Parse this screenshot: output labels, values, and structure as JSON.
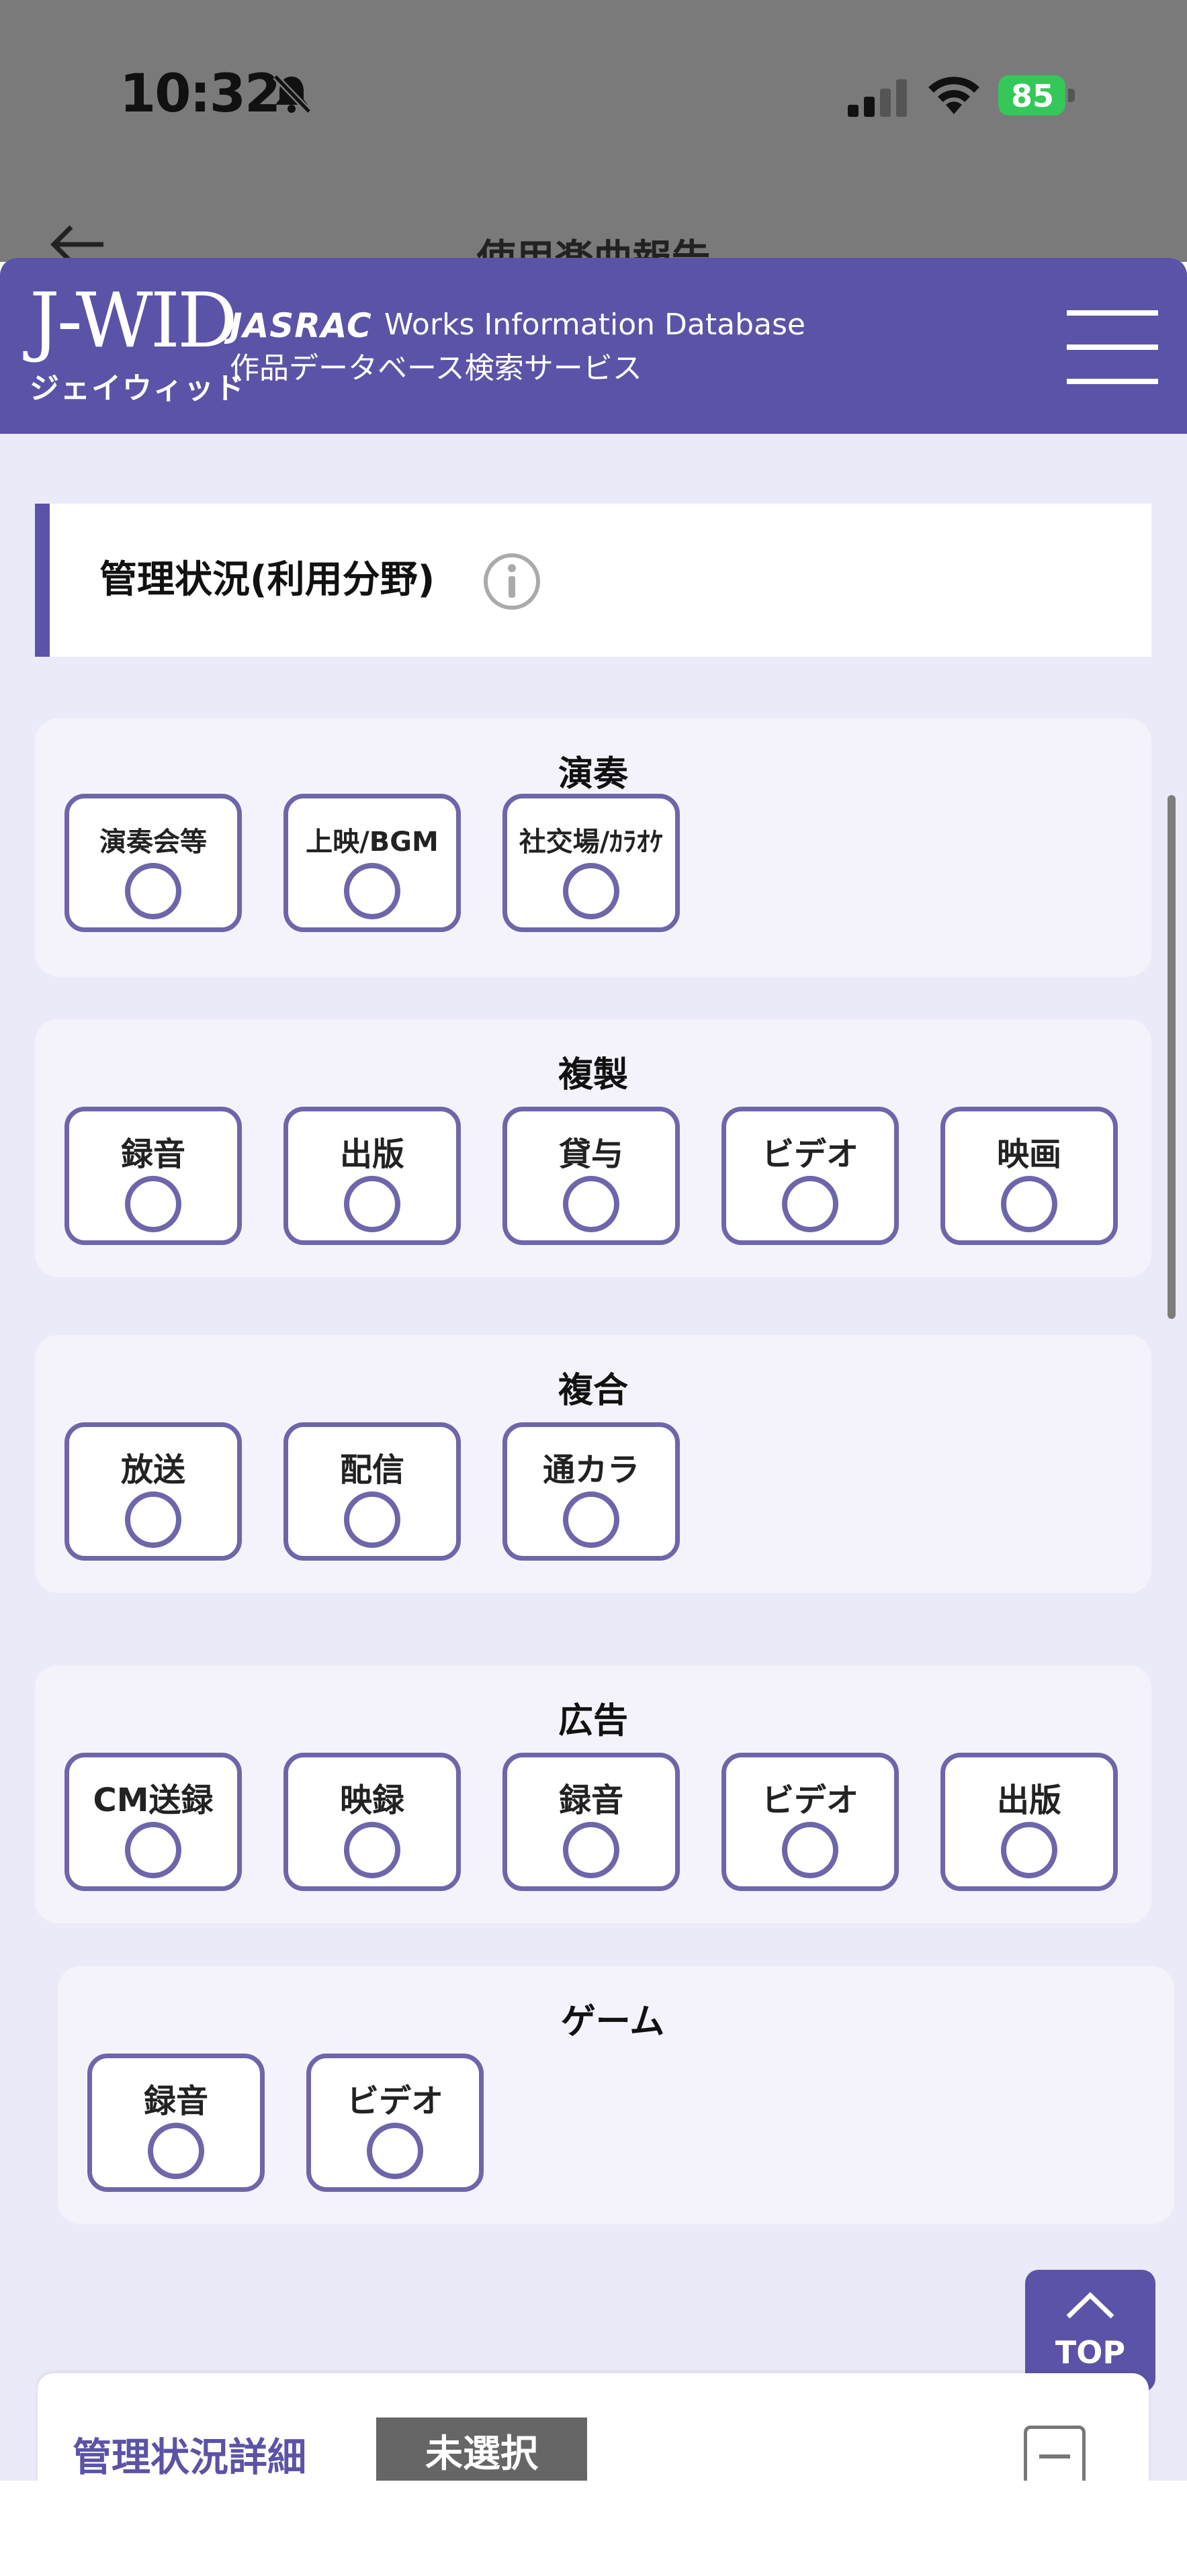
{
  "status_bar": {
    "time": "10:32",
    "battery": "85"
  },
  "behind_screen": {
    "title": "使用楽曲報告"
  },
  "header": {
    "logo_mark": "J-WID",
    "logo_kana": "ジェイウィッド",
    "brand": "JASRAC",
    "subtitle_en": "Works Information Database",
    "subtitle_jp": "作品データベース検索サービス"
  },
  "section": {
    "title": "管理状況(利用分野)"
  },
  "groups": [
    {
      "title": "演奏",
      "options": [
        "演奏会等",
        "上映/BGM",
        "社交場/ｶﾗｵｹ"
      ]
    },
    {
      "title": "複製",
      "options": [
        "録音",
        "出版",
        "貸与",
        "ビデオ",
        "映画"
      ]
    },
    {
      "title": "複合",
      "options": [
        "放送",
        "配信",
        "通カラ"
      ]
    },
    {
      "title": "広告",
      "options": [
        "CM送録",
        "映録",
        "録音",
        "ビデオ",
        "出版"
      ]
    },
    {
      "title": "ゲーム",
      "options": [
        "録音",
        "ビデオ"
      ]
    }
  ],
  "top_button": {
    "label": "TOP"
  },
  "detail": {
    "title": "管理状況詳細",
    "badge": "未選択"
  },
  "colors": {
    "primary": "#5b53a7",
    "option_border": "#6d66aa",
    "background": "#ebeaf8"
  }
}
